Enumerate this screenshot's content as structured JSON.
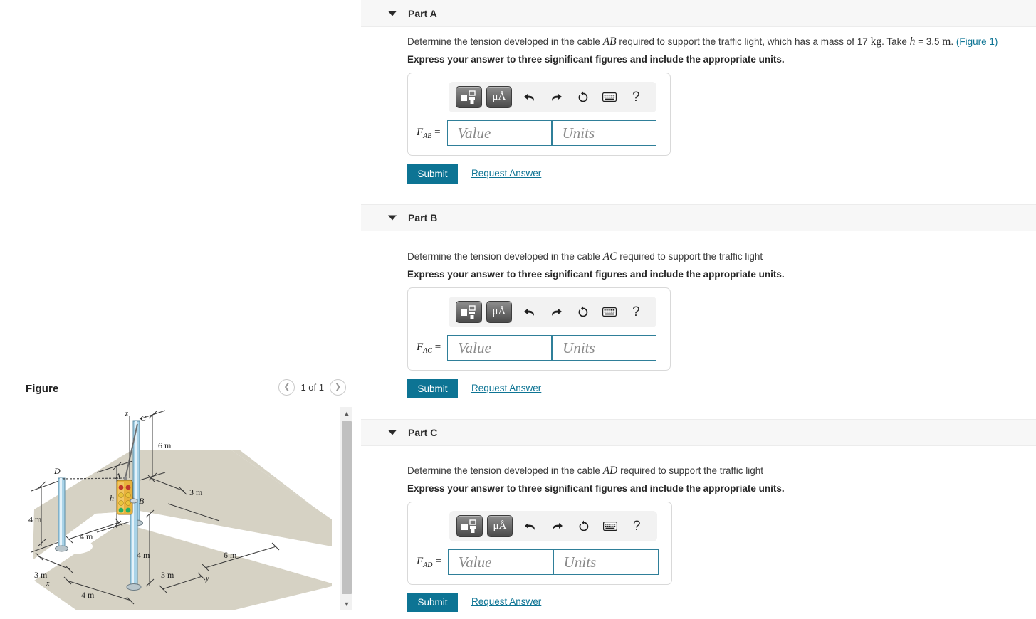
{
  "figure_panel": {
    "title": "Figure",
    "nav": {
      "prev_icon": "chevron-left-icon",
      "next_icon": "chevron-right-icon",
      "counter": "1 of 1"
    },
    "diagram": {
      "alt": "Isometric drawing of a traffic light suspended by cables AB, AC and AD from three poles over a road intersection",
      "point_labels": [
        "z",
        "C",
        "D",
        "A",
        "B",
        "h",
        "x",
        "y"
      ],
      "dimension_labels": [
        "6 m",
        "3 m",
        "4 m",
        "4 m",
        "3 m",
        "4 m",
        "4 m",
        "6 m",
        "3 m"
      ],
      "colors": {
        "pole": "#a9d3e8",
        "pole_edge": "#5c8ea6",
        "ground": "#d6d2c4",
        "road": "#ffffff",
        "traffic_light_body": "#e8b23c",
        "lamp_red": "#c0392b",
        "lamp_yellow": "#e8c33c",
        "lamp_green": "#27ae60",
        "cable": "#6f6f6f"
      }
    },
    "scrollbar": {
      "up_icon": "triangle-up-icon",
      "down_icon": "triangle-down-icon"
    }
  },
  "parts": [
    {
      "id": "part-a",
      "label": "Part A",
      "caret_icon": "caret-down-icon",
      "prompt_pre": "Determine the tension developed in the cable ",
      "prompt_var": "AB",
      "prompt_mid": " required to support the traffic light, which has a mass of 17",
      "prompt_unit": "kg",
      "prompt_take": ". Take ",
      "prompt_h": "h",
      "prompt_h_val": " = 3.5",
      "prompt_h_unit": "m",
      "prompt_link": "(Figure 1)",
      "instruction": "Express your answer to three significant figures and include the appropriate units.",
      "answer": {
        "symbol_base": "F",
        "symbol_sub": "AB",
        "equals": "=",
        "value_placeholder": "Value",
        "units_placeholder": "Units"
      },
      "toolbar": {
        "template_icon": "math-template-icon",
        "units_icon": "micro-angstrom-units-icon",
        "units_label": "μÅ",
        "undo_icon": "undo-arrow-icon",
        "redo_icon": "redo-arrow-icon",
        "reset_icon": "reset-circular-arrow-icon",
        "keyboard_icon": "keyboard-icon",
        "help_icon": "question-mark-icon",
        "help_label": "?"
      },
      "submit_label": "Submit",
      "request_label": "Request Answer"
    },
    {
      "id": "part-b",
      "label": "Part B",
      "caret_icon": "caret-down-icon",
      "prompt_pre": "Determine the tension developed in the cable ",
      "prompt_var": "AC",
      "prompt_mid": " required to support the traffic light",
      "instruction": "Express your answer to three significant figures and include the appropriate units.",
      "answer": {
        "symbol_base": "F",
        "symbol_sub": "AC",
        "equals": "=",
        "value_placeholder": "Value",
        "units_placeholder": "Units"
      },
      "toolbar": {
        "template_icon": "math-template-icon",
        "units_icon": "micro-angstrom-units-icon",
        "units_label": "μÅ",
        "undo_icon": "undo-arrow-icon",
        "redo_icon": "redo-arrow-icon",
        "reset_icon": "reset-circular-arrow-icon",
        "keyboard_icon": "keyboard-icon",
        "help_icon": "question-mark-icon",
        "help_label": "?"
      },
      "submit_label": "Submit",
      "request_label": "Request Answer"
    },
    {
      "id": "part-c",
      "label": "Part C",
      "caret_icon": "caret-down-icon",
      "prompt_pre": "Determine the tension developed in the cable ",
      "prompt_var": "AD",
      "prompt_mid": " required to support the traffic light",
      "instruction": "Express your answer to three significant figures and include the appropriate units.",
      "answer": {
        "symbol_base": "F",
        "symbol_sub": "AD",
        "equals": "=",
        "value_placeholder": "Value",
        "units_placeholder": "Units"
      },
      "toolbar": {
        "template_icon": "math-template-icon",
        "units_icon": "micro-angstrom-units-icon",
        "units_label": "μÅ",
        "undo_icon": "undo-arrow-icon",
        "redo_icon": "redo-arrow-icon",
        "reset_icon": "reset-circular-arrow-icon",
        "keyboard_icon": "keyboard-icon",
        "help_icon": "question-mark-icon",
        "help_label": "?"
      },
      "submit_label": "Submit",
      "request_label": "Request Answer"
    }
  ],
  "colors": {
    "accent": "#0d7494",
    "band": "#f7f7f7",
    "field_border": "#2f7f99"
  }
}
